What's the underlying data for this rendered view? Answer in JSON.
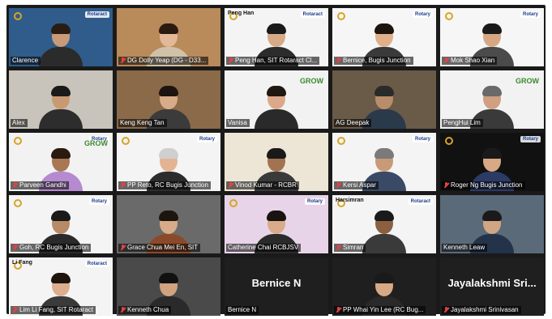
{
  "gallery": {
    "tiles": [
      {
        "name": "Clarence",
        "muted": false,
        "speaker": true,
        "bg": "#2f5c8a",
        "shirt": "#2b2b2b",
        "skin": "#c99a78",
        "hair": "#2a1c12",
        "top_name": "",
        "big_name": "",
        "badge": "Rotaract",
        "grow": ""
      },
      {
        "name": "DG Dolly Yeap (DG - D33...",
        "muted": true,
        "speaker": false,
        "bg": "#b98a5a",
        "shirt": "#d1c1a8",
        "skin": "#e2b897",
        "hair": "#2a1a10",
        "top_name": "",
        "big_name": "",
        "badge": "",
        "grow": ""
      },
      {
        "name": "Peng Han, SIT Rotaract Cl...",
        "muted": true,
        "speaker": false,
        "bg": "#f4f4f4",
        "shirt": "#2c2c2c",
        "skin": "#d7a985",
        "hair": "#1a1a1a",
        "top_name": "Peng Han",
        "big_name": "",
        "badge": "Rotaract",
        "grow": ""
      },
      {
        "name": "Bernice, Bugis Junction",
        "muted": true,
        "speaker": false,
        "bg": "#f6f6f6",
        "shirt": "#3a3a3a",
        "skin": "#e0b08a",
        "hair": "#1e140e",
        "top_name": "",
        "big_name": "",
        "badge": "Rotary",
        "grow": ""
      },
      {
        "name": "Mok Shao Xian",
        "muted": true,
        "speaker": false,
        "bg": "#f6f6f6",
        "shirt": "#4b4b4b",
        "skin": "#d7a783",
        "hair": "#1a1a1a",
        "top_name": "",
        "big_name": "",
        "badge": "Rotary",
        "grow": ""
      },
      {
        "name": "Alex",
        "muted": false,
        "speaker": false,
        "bg": "#c9c4bb",
        "shirt": "#2d2d2d",
        "skin": "#c99a72",
        "hair": "#1a1a1a",
        "top_name": "",
        "big_name": "",
        "badge": "",
        "grow": ""
      },
      {
        "name": "Keng Keng Tan",
        "muted": false,
        "speaker": false,
        "bg": "#8a6a48",
        "shirt": "#3b3b3b",
        "skin": "#d8ac88",
        "hair": "#1e1410",
        "top_name": "",
        "big_name": "",
        "badge": "",
        "grow": ""
      },
      {
        "name": "Vanisa",
        "muted": false,
        "speaker": false,
        "bg": "#f2f2f2",
        "shirt": "#2a2a2a",
        "skin": "#dba98a",
        "hair": "#201612",
        "top_name": "",
        "big_name": "",
        "badge": "",
        "grow": "GROW"
      },
      {
        "name": "AG Deepak",
        "muted": false,
        "speaker": false,
        "bg": "#6a5a48",
        "shirt": "#2b3a4a",
        "skin": "#b98d6a",
        "hair": "#2a2a2a",
        "top_name": "",
        "big_name": "",
        "badge": "",
        "grow": ""
      },
      {
        "name": "PengHui Lim",
        "muted": false,
        "speaker": false,
        "bg": "#f2f2f2",
        "shirt": "#3a3a3a",
        "skin": "#d0a080",
        "hair": "#6a6a6a",
        "top_name": "",
        "big_name": "",
        "badge": "",
        "grow": "GROW"
      },
      {
        "name": "Parveen Gandhi",
        "muted": true,
        "speaker": false,
        "bg": "#f2f2f2",
        "shirt": "#b58ad0",
        "skin": "#a97752",
        "hair": "#2a1a10",
        "top_name": "",
        "big_name": "",
        "badge": "Rotary",
        "grow": "GROW"
      },
      {
        "name": "PP Reto, RC Bugis Junction",
        "muted": true,
        "speaker": false,
        "bg": "#f4f4f4",
        "shirt": "#2c2c2c",
        "skin": "#e3b493",
        "hair": "#cfcfcf",
        "top_name": "",
        "big_name": "",
        "badge": "Rotary",
        "grow": ""
      },
      {
        "name": "Vinod Kumar - RCBR",
        "muted": true,
        "speaker": false,
        "bg": "#ede6d6",
        "shirt": "#3a3a3a",
        "skin": "#a27350",
        "hair": "#1a1a1a",
        "top_name": "",
        "big_name": "",
        "badge": "",
        "grow": ""
      },
      {
        "name": "Kersi Aspar",
        "muted": true,
        "speaker": false,
        "bg": "#f4f4f4",
        "shirt": "#3a4a66",
        "skin": "#c99a78",
        "hair": "#7a7a7a",
        "top_name": "",
        "big_name": "",
        "badge": "Rotary",
        "grow": ""
      },
      {
        "name": "Roger Ng Bugis Junction",
        "muted": true,
        "speaker": false,
        "bg": "#111111",
        "shirt": "#2b3b66",
        "skin": "#d7a985",
        "hair": "#1a1a1a",
        "top_name": "",
        "big_name": "",
        "badge": "Rotary",
        "grow": ""
      },
      {
        "name": "Goh, RC Bugis Junction",
        "muted": true,
        "speaker": false,
        "bg": "#f4f4f4",
        "shirt": "#2a2a2a",
        "skin": "#b88a66",
        "hair": "#1a1a1a",
        "top_name": "",
        "big_name": "",
        "badge": "Rotary",
        "grow": ""
      },
      {
        "name": "Grace Chua Mei En, SIT",
        "muted": true,
        "speaker": false,
        "bg": "#6a6a6a",
        "shirt": "#8a4a2a",
        "skin": "#d8ab88",
        "hair": "#1e140e",
        "top_name": "",
        "big_name": "",
        "badge": "",
        "grow": ""
      },
      {
        "name": "Catherine Chai RCBJSV",
        "muted": false,
        "speaker": false,
        "bg": "#e8d4e8",
        "shirt": "#2a2a2a",
        "skin": "#d9ab88",
        "hair": "#1a1410",
        "top_name": "",
        "big_name": "",
        "badge": "Rotary",
        "grow": ""
      },
      {
        "name": "Simran",
        "muted": true,
        "speaker": false,
        "bg": "#f4f4f4",
        "shirt": "#3a3a3a",
        "skin": "#8a6040",
        "hair": "#1a1a1a",
        "top_name": "Harsimran",
        "big_name": "",
        "badge": "Rotaract",
        "grow": ""
      },
      {
        "name": "Kenneth Leaw",
        "muted": false,
        "speaker": false,
        "bg": "#5a6a78",
        "shirt": "#22334a",
        "skin": "#d3a683",
        "hair": "#1a1a1a",
        "top_name": "",
        "big_name": "",
        "badge": "",
        "grow": ""
      },
      {
        "name": "Lim Li Fang, SIT Rotaract",
        "muted": true,
        "speaker": false,
        "bg": "#f4f4f4",
        "shirt": "#3a3a3a",
        "skin": "#dcae8e",
        "hair": "#1e140e",
        "top_name": "Li Fang",
        "big_name": "",
        "badge": "Rotaract",
        "grow": ""
      },
      {
        "name": "Kenneth Chua",
        "muted": true,
        "speaker": false,
        "bg": "#4a4a4a",
        "shirt": "#2a2a2a",
        "skin": "#d1a27e",
        "hair": "#111111",
        "top_name": "",
        "big_name": "",
        "badge": "",
        "grow": ""
      },
      {
        "name": "Bernice N",
        "muted": false,
        "speaker": false,
        "bg": "#1f1f1f",
        "shirt": "",
        "skin": "",
        "hair": "",
        "top_name": "",
        "big_name": "Bernice N",
        "badge": "",
        "grow": ""
      },
      {
        "name": "PP Whai Yin Lee (RC Bug...",
        "muted": true,
        "speaker": false,
        "bg": "#1f1f1f",
        "shirt": "#2a2a2a",
        "skin": "#d7a985",
        "hair": "#1a1a1a",
        "top_name": "",
        "big_name": "",
        "badge": "",
        "grow": ""
      },
      {
        "name": "Jayalakshmi Srinivasan",
        "muted": true,
        "speaker": false,
        "bg": "#1f1f1f",
        "shirt": "",
        "skin": "",
        "hair": "",
        "top_name": "",
        "big_name": "Jayalakshmi Sri...",
        "badge": "",
        "grow": ""
      }
    ]
  }
}
